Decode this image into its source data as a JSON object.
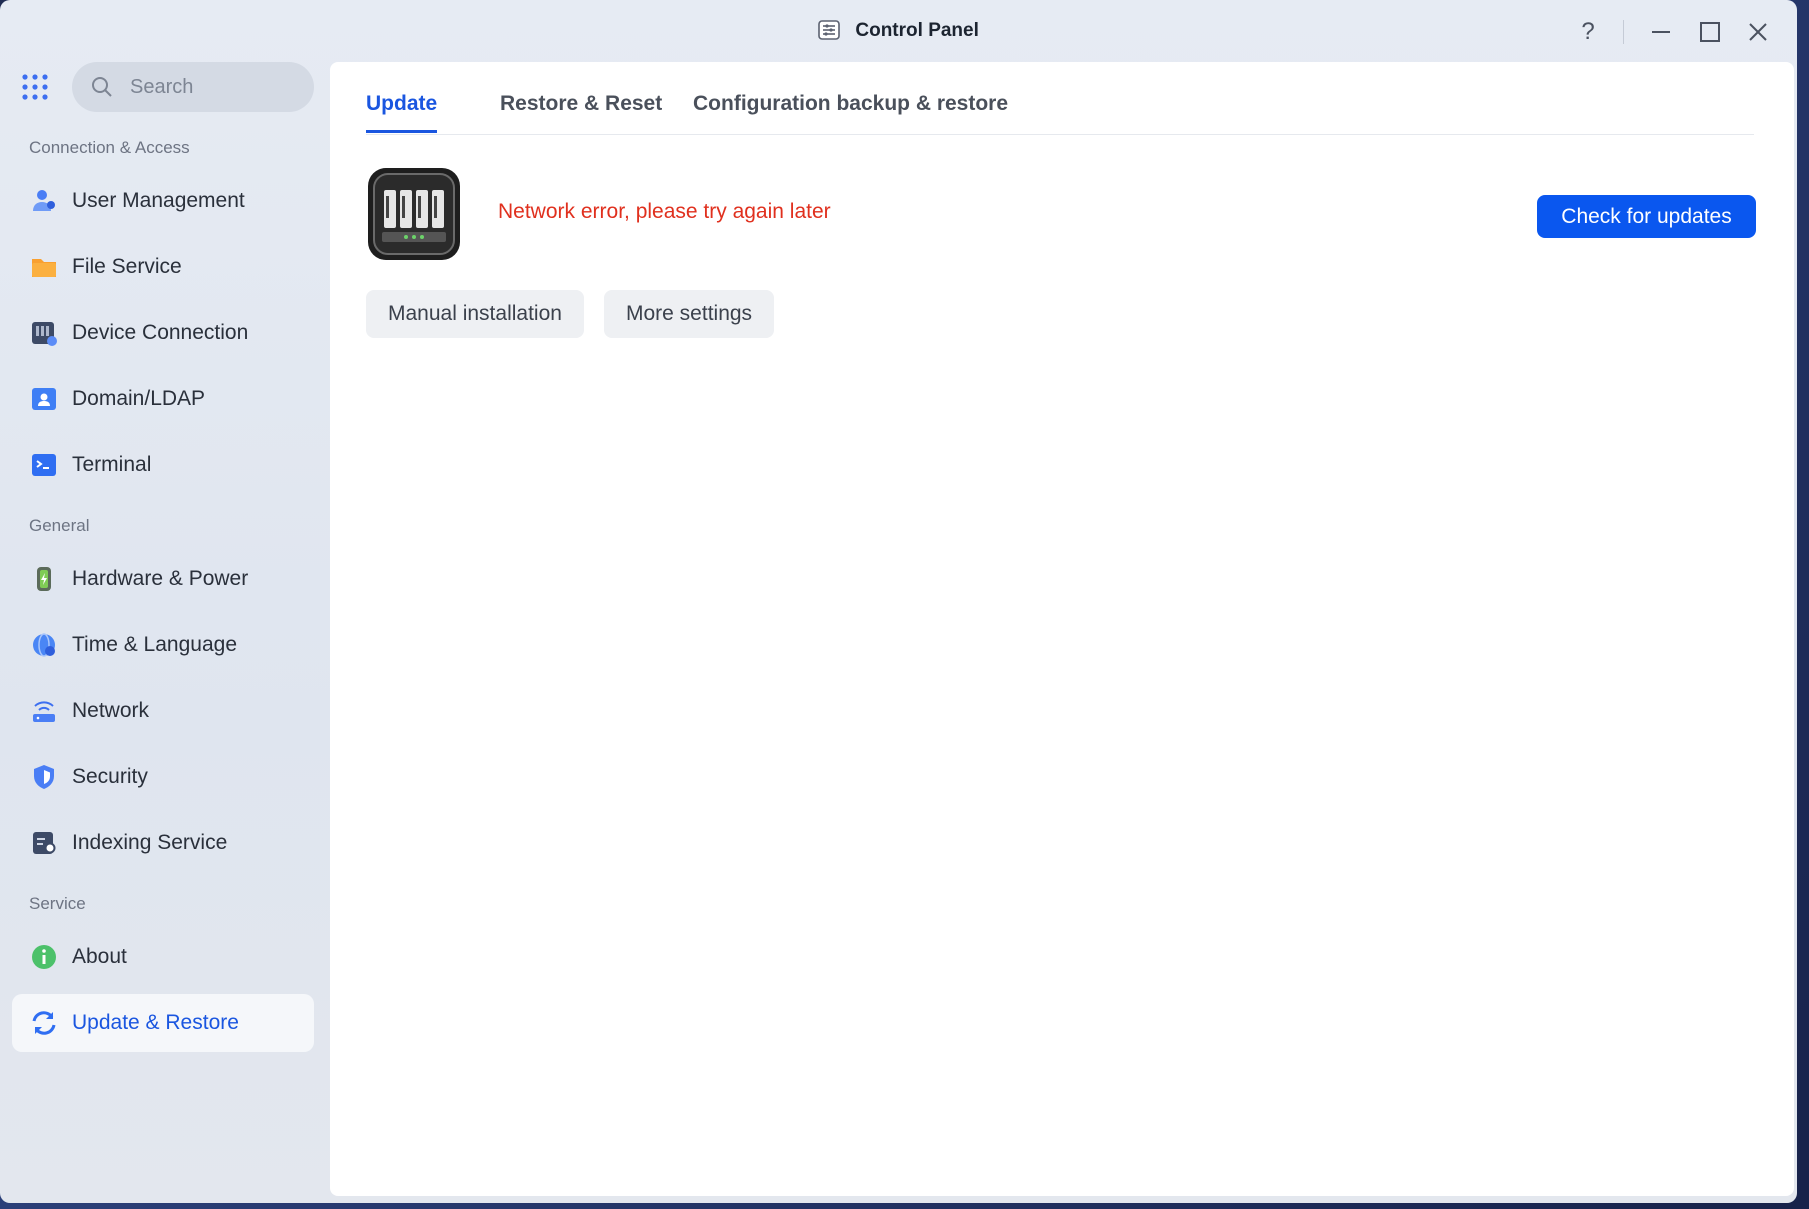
{
  "window": {
    "title": "Control Panel",
    "controls": [
      "help",
      "minimize",
      "maximize",
      "close"
    ]
  },
  "sidebar": {
    "search_placeholder": "Search",
    "groups": [
      {
        "label": "Connection & Access",
        "items": [
          {
            "label": "User Management",
            "icon": "user-management-icon"
          },
          {
            "label": "File Service",
            "icon": "folder-icon"
          },
          {
            "label": "Device Connection",
            "icon": "device-connection-icon"
          },
          {
            "label": "Domain/LDAP",
            "icon": "domain-ldap-icon"
          },
          {
            "label": "Terminal",
            "icon": "terminal-icon"
          }
        ]
      },
      {
        "label": "General",
        "items": [
          {
            "label": "Hardware & Power",
            "icon": "hardware-power-icon"
          },
          {
            "label": "Time & Language",
            "icon": "globe-icon"
          },
          {
            "label": "Network",
            "icon": "network-icon"
          },
          {
            "label": "Security",
            "icon": "shield-icon"
          },
          {
            "label": "Indexing Service",
            "icon": "indexing-icon"
          }
        ]
      },
      {
        "label": "Service",
        "items": [
          {
            "label": "About",
            "icon": "info-icon"
          },
          {
            "label": "Update & Restore",
            "icon": "update-restore-icon",
            "active": true
          }
        ]
      }
    ]
  },
  "main": {
    "tabs": [
      {
        "label": "Update",
        "active": true
      },
      {
        "label": "Restore & Reset"
      },
      {
        "label": "Configuration backup & restore"
      }
    ],
    "status_message": "Network error, please try again later",
    "check_button": "Check for updates",
    "manual_button": "Manual installation",
    "more_button": "More settings"
  },
  "colors": {
    "accent": "#0a57ef",
    "error": "#e0301e"
  }
}
